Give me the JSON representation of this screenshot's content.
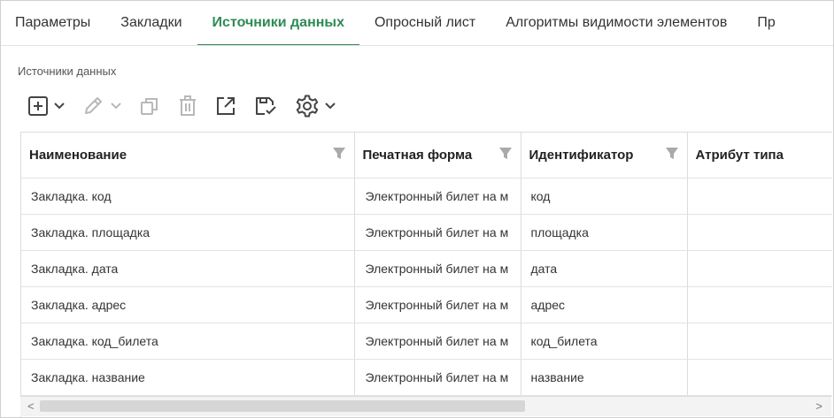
{
  "tabs": [
    {
      "label": "Параметры",
      "active": false
    },
    {
      "label": "Закладки",
      "active": false
    },
    {
      "label": "Источники данных",
      "active": true
    },
    {
      "label": "Опросный лист",
      "active": false
    },
    {
      "label": "Алгоритмы видимости элементов",
      "active": false
    },
    {
      "label": "Пр",
      "active": false
    }
  ],
  "section_title": "Источники данных",
  "toolbar": {
    "buttons": [
      "add-icon",
      "edit-icon",
      "copy-icon",
      "delete-icon",
      "open-external-icon",
      "save-check-icon",
      "settings-icon"
    ]
  },
  "table": {
    "columns": [
      "Наименование",
      "Печатная форма",
      "Идентификатор",
      "Атрибут типа"
    ],
    "rows": [
      [
        "Закладка. код",
        "Электронный билет на м",
        "код",
        ""
      ],
      [
        "Закладка. площадка",
        "Электронный билет на м",
        "площадка",
        ""
      ],
      [
        "Закладка. дата",
        "Электронный билет на м",
        "дата",
        ""
      ],
      [
        "Закладка. адрес",
        "Электронный билет на м",
        "адрес",
        ""
      ],
      [
        "Закладка. код_билета",
        "Электронный билет на м",
        "код_билета",
        ""
      ],
      [
        "Закладка. название",
        "Электронный билет на м",
        "название",
        ""
      ]
    ]
  },
  "scrollbar": {
    "left_arrow": "<",
    "right_arrow": ">"
  },
  "colors": {
    "accent": "#2e8b57",
    "icon": "#444444",
    "icon_disabled": "#b8b8b8"
  }
}
